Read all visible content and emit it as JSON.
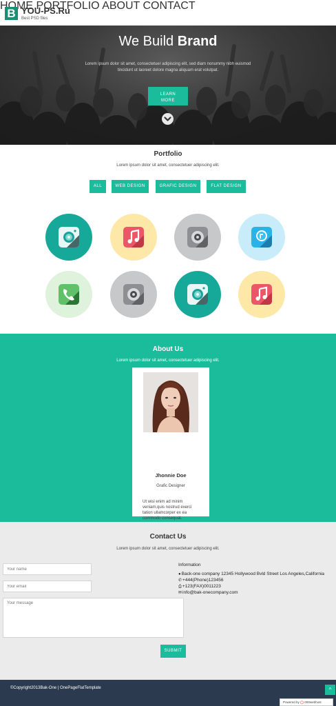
{
  "header": {
    "logo_letter": "B",
    "title": "YOU-PS.Ru",
    "subtitle": "Best PSD files",
    "nav": [
      {
        "label": "HOME"
      },
      {
        "label": "PORTFOLIO"
      },
      {
        "label": "ABOUT"
      },
      {
        "label": "CONTACT"
      }
    ]
  },
  "hero": {
    "title_light": "We Build",
    "title_bold": "Brand",
    "text": "Lorem ipsum dolor sit amet, consectetuer adipiscing elit, sed diam nonummy nibh euismod tincidunt ut laoreet dolore magna aliquam erat volutpat.",
    "button_line1": "LEARN",
    "button_line2": "MORE"
  },
  "portfolio": {
    "title": "Portfolio",
    "subtitle": "Lorem ipsum dolor sit amet, consectetuer adipiscing elit.",
    "filters": [
      {
        "label": "ALL"
      },
      {
        "label": "WEB DESIGN"
      },
      {
        "label": "GRAFIC DESIGN"
      },
      {
        "label": "FLAT DESIGN"
      }
    ],
    "items": [
      {
        "icon": "camera-icon",
        "bg": "#16a999"
      },
      {
        "icon": "music-icon",
        "bg": "#fde8a7"
      },
      {
        "icon": "settings-icon",
        "bg": "#c7c8ca"
      },
      {
        "icon": "maps-icon",
        "bg": "#c9ecfa"
      },
      {
        "icon": "phone-icon",
        "bg": "#dff2dc"
      },
      {
        "icon": "settings-icon",
        "bg": "#c7c8ca"
      },
      {
        "icon": "camera-icon",
        "bg": "#16a999"
      },
      {
        "icon": "music-icon",
        "bg": "#fde8a7"
      }
    ]
  },
  "about": {
    "title": "About Us",
    "subtitle": "Lorem ipsum dolor sit amet, consectetuer adipiscing elit.",
    "name": "Jhonnie Doe",
    "role": "Grafic Designer",
    "text": "Ut wisi enim ad minim veniam,quis nostrud exerci tation ullamcorper ex ea commodo consequat."
  },
  "contact": {
    "title": "Contact Us",
    "subtitle": "Lorem ipsum dolor sit amet, consectetuer adipiscing elit.",
    "name_placeholder": "Your name",
    "email_placeholder": "Your email",
    "message_placeholder": "Your message",
    "submit_label": "SUBMIT",
    "info_title": "Information",
    "address": "Back-one company 12345 Hollywood Bvld Street Los Angeles,California",
    "phone": "+444(Phone)123456",
    "fax": "+123(FAX)0011223",
    "email": "info@bak-onecompany.com"
  },
  "footer": {
    "copyright": "©Copyright2013Bak-One | OnePageFlatTemplate",
    "top_arrow": "^",
    "powered_label": "Powered by",
    "powered_brand": "000webhost"
  },
  "colors": {
    "accent": "#1abc9c",
    "footer": "#2b3a4e",
    "contact_bg": "#ebebeb"
  }
}
